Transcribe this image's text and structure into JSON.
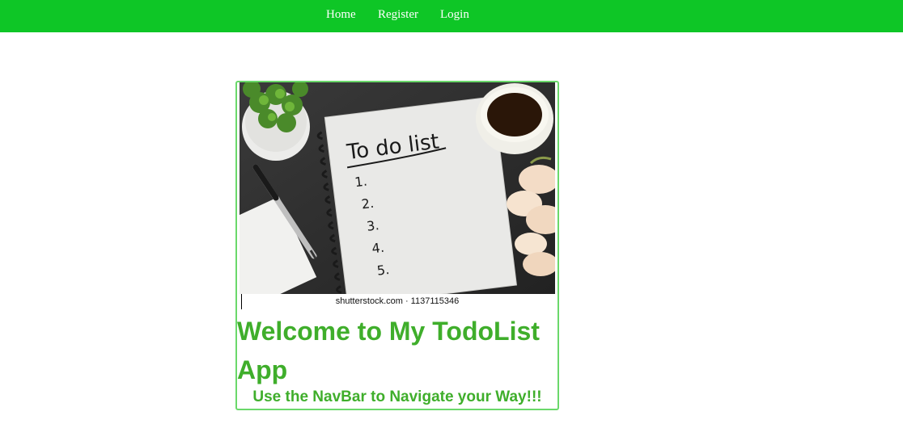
{
  "nav": {
    "items": [
      {
        "label": "Home"
      },
      {
        "label": "Register"
      },
      {
        "label": "Login"
      }
    ],
    "bg_color": "#0ec626"
  },
  "card": {
    "border_color": "#6ad86a",
    "image": {
      "description_icon": "todo-list-notebook-photo",
      "notebook_heading": "To do list",
      "list_numbers": [
        "1.",
        "2.",
        "3.",
        "4.",
        "5."
      ]
    },
    "caption": "shutterstock.com · 1137115346",
    "title": "Welcome to My TodoList App",
    "subtitle": "Use the NavBar to Navigate your Way!!!",
    "text_color": "#3fae2b"
  }
}
